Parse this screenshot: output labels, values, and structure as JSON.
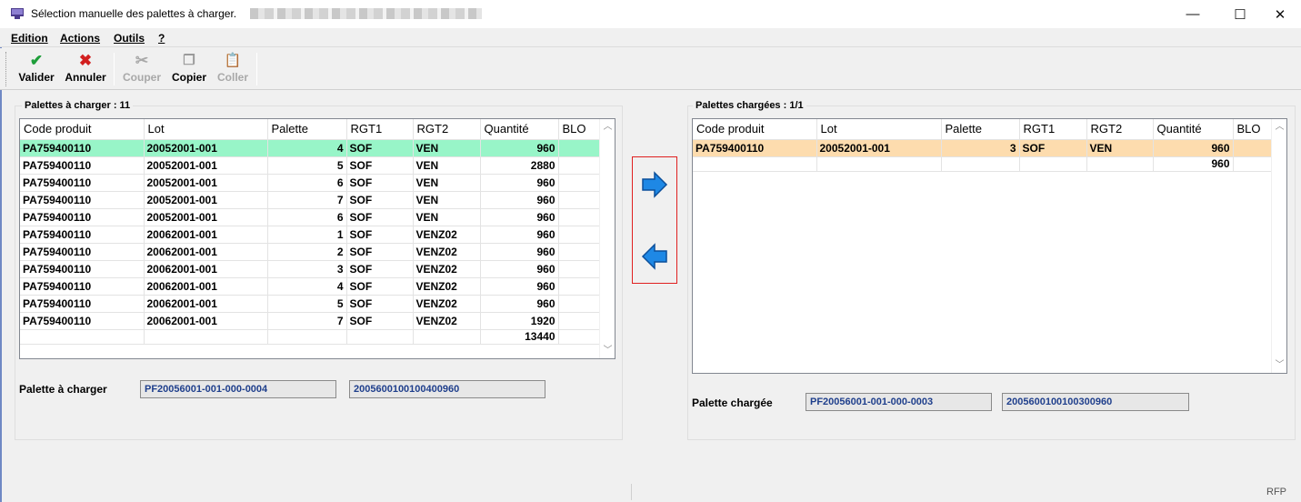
{
  "window": {
    "title": "Sélection manuelle des palettes à charger.",
    "min_label": "—",
    "max_label": "☐",
    "close_label": "✕"
  },
  "menu": [
    "Edition",
    "Actions",
    "Outils",
    "?"
  ],
  "toolbar": {
    "validate_label": "Valider",
    "cancel_label": "Annuler",
    "cut_label": "Couper",
    "copy_label": "Copier",
    "paste_label": "Coller"
  },
  "left": {
    "title": "Palettes à charger : 11",
    "columns": [
      "Code produit",
      "Lot",
      "Palette",
      "RGT1",
      "RGT2",
      "Quantité",
      "BLO"
    ],
    "rows": [
      [
        "PA759400110",
        "20052001-001",
        "4",
        "SOF",
        "VEN",
        "960",
        ""
      ],
      [
        "PA759400110",
        "20052001-001",
        "5",
        "SOF",
        "VEN",
        "2880",
        ""
      ],
      [
        "PA759400110",
        "20052001-001",
        "6",
        "SOF",
        "VEN",
        "960",
        ""
      ],
      [
        "PA759400110",
        "20052001-001",
        "7",
        "SOF",
        "VEN",
        "960",
        ""
      ],
      [
        "PA759400110",
        "20052001-001",
        "6",
        "SOF",
        "VEN",
        "960",
        ""
      ],
      [
        "PA759400110",
        "20062001-001",
        "1",
        "SOF",
        "VENZ02",
        "960",
        ""
      ],
      [
        "PA759400110",
        "20062001-001",
        "2",
        "SOF",
        "VENZ02",
        "960",
        ""
      ],
      [
        "PA759400110",
        "20062001-001",
        "3",
        "SOF",
        "VENZ02",
        "960",
        ""
      ],
      [
        "PA759400110",
        "20062001-001",
        "4",
        "SOF",
        "VENZ02",
        "960",
        ""
      ],
      [
        "PA759400110",
        "20062001-001",
        "5",
        "SOF",
        "VENZ02",
        "960",
        ""
      ],
      [
        "PA759400110",
        "20062001-001",
        "7",
        "SOF",
        "VENZ02",
        "1920",
        ""
      ]
    ],
    "total": "13440",
    "field_label": "Palette à charger",
    "field_code": "PF20056001-001-000-0004",
    "field_barcode": "2005600100100400960"
  },
  "right": {
    "title": "Palettes chargées : 1/1",
    "columns": [
      "Code produit",
      "Lot",
      "Palette",
      "RGT1",
      "RGT2",
      "Quantité",
      "BLO"
    ],
    "rows": [
      [
        "PA759400110",
        "20052001-001",
        "3",
        "SOF",
        "VEN",
        "960",
        ""
      ]
    ],
    "total": "960",
    "field_label": "Palette chargée",
    "field_code": "PF20056001-001-000-0003",
    "field_barcode": "2005600100100300960"
  },
  "status": {
    "right_text": "RFP"
  },
  "colors": {
    "selected_left": "#98f5c8",
    "selected_right": "#fddcae",
    "arrow_blue": "#1e88e5",
    "highlight_box": "#e02020"
  }
}
